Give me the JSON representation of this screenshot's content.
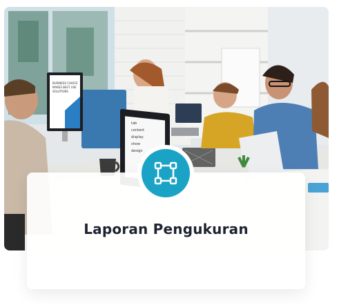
{
  "card": {
    "title": "Laporan Pengukuran",
    "icon": "vector-square-icon",
    "accent_color": "#1ba3c6",
    "title_color": "#1d2330"
  },
  "photo": {
    "monitor_text_left": [
      "BUSINESS CHOICE",
      "MAKES BEST USE",
      "SOLUTIONS"
    ],
    "monitor_text_center": [
      "tab",
      "content",
      "display",
      "show",
      "design"
    ]
  }
}
